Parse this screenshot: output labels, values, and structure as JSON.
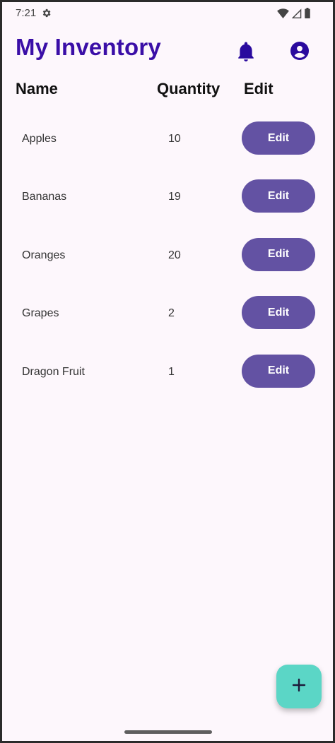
{
  "status_bar": {
    "time": "7:21",
    "icons": [
      "settings-gear-icon",
      "wifi-icon",
      "signal-icon",
      "battery-icon"
    ]
  },
  "app_bar": {
    "title": "My Inventory",
    "actions": [
      "bell-icon",
      "account-icon"
    ]
  },
  "table": {
    "headers": {
      "name": "Name",
      "quantity": "Quantity",
      "edit": "Edit"
    },
    "rows": [
      {
        "name": "Apples",
        "quantity": "10",
        "edit_label": "Edit"
      },
      {
        "name": "Bananas",
        "quantity": "19",
        "edit_label": "Edit"
      },
      {
        "name": "Oranges",
        "quantity": "20",
        "edit_label": "Edit"
      },
      {
        "name": "Grapes",
        "quantity": "2",
        "edit_label": "Edit"
      },
      {
        "name": "Dragon Fruit",
        "quantity": "1",
        "edit_label": "Edit"
      }
    ]
  },
  "fab": {
    "icon": "plus-icon"
  },
  "colors": {
    "title": "#3a0ea7",
    "button": "#6352a3",
    "fab": "#5bd6c6",
    "background": "#fdf7fc"
  }
}
